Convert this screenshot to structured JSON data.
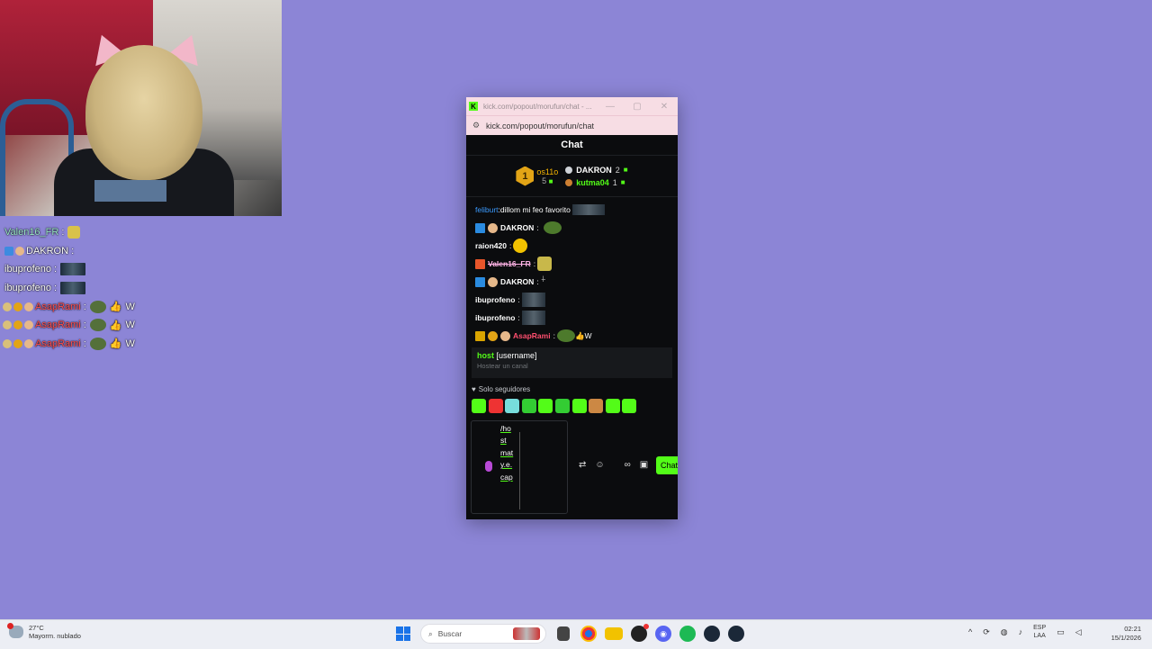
{
  "overlay_chat": {
    "messages": [
      {
        "user": "Valen16_FR",
        "sep": " : ",
        "color": "#9be7c8",
        "emote": "face-emote",
        "badges": []
      },
      {
        "user": "DAKRON",
        "sep": " : ",
        "color": "#ffffff",
        "emote": "",
        "badges": [
          "sword"
        ]
      },
      {
        "user": "ibuprofeno",
        "sep": " : ",
        "color": "#ffffff",
        "emote": "gif-emote",
        "badges": []
      },
      {
        "user": "ibuprofeno",
        "sep": " : ",
        "color": "#ffffff",
        "emote": "gif-emote",
        "badges": []
      },
      {
        "user": "AsapRami",
        "sep": " : ",
        "color": "#ff4f4f",
        "emote": "pepe-thumb",
        "text": "W",
        "badges": [
          "crown",
          "1",
          "crown"
        ]
      },
      {
        "user": "AsapRami",
        "sep": " : ",
        "color": "#ff4f4f",
        "emote": "pepe-thumb",
        "text": "W",
        "badges": [
          "crown",
          "1",
          "crown"
        ]
      },
      {
        "user": "AsapRami",
        "sep": " : ",
        "color": "#ff4f4f",
        "emote": "pepe-thumb",
        "text": "W",
        "badges": [
          "crown",
          "1",
          "crown"
        ]
      }
    ]
  },
  "window": {
    "title": "kick.com/popout/morufun/chat - ...",
    "url": "kick.com/popout/morufun/chat",
    "header": "Chat",
    "top_gifters": {
      "first": {
        "rank": "1",
        "name": "os11o",
        "count": "5"
      },
      "second": {
        "name": "DAKRON",
        "count": "2"
      },
      "third": {
        "name": "kutma04",
        "count": "1"
      }
    },
    "messages": [
      {
        "user": "feliburt",
        "sep": ":",
        "text": " dillom mi feo favorito",
        "color": "#3b9bff"
      },
      {
        "user": "DAKRON",
        "sep": ":",
        "text": "",
        "color": "#ffffff"
      },
      {
        "user": "raion420",
        "sep": ":",
        "text": "",
        "color": "#ffffff"
      },
      {
        "user": "Valen16_FR",
        "sep": ":",
        "text": "",
        "color": "#ffb3e6"
      },
      {
        "user": "DAKRON",
        "sep": ":",
        "text": "",
        "color": "#ffffff"
      },
      {
        "user": "ibuprofeno",
        "sep": ":",
        "text": "",
        "color": "#ffffff"
      },
      {
        "user": "ibuprofeno",
        "sep": ":",
        "text": "",
        "color": "#ffffff"
      },
      {
        "user": "AsapRami",
        "sep": ":",
        "text": "W",
        "color": "#ff4f6f"
      }
    ],
    "command": {
      "name": "host",
      "arg": " [username]",
      "desc": "Hostear un canal"
    },
    "followers_only": "Solo seguidores",
    "input_text": "/host maty.e.cap",
    "send_label": "Chat",
    "emote_colors": [
      "#53fc18",
      "#e33",
      "#7dd",
      "#3c3",
      "#53fc18",
      "#3c3",
      "#53fc18",
      "#c84",
      "#53fc18",
      "#53fc18"
    ]
  },
  "taskbar": {
    "weather_temp": "27°C",
    "weather_desc": "Mayorm. nublado",
    "search_placeholder": "Buscar",
    "lang_top": "ESP",
    "lang_bottom": "LAA",
    "time": "02:21",
    "date": "15/1/2026"
  }
}
